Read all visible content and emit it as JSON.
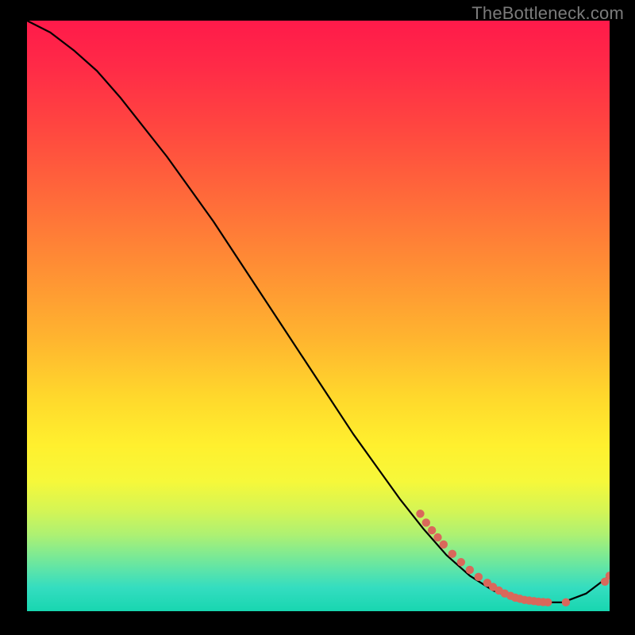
{
  "watermark": "TheBottleneck.com",
  "chart_data": {
    "type": "line",
    "title": "",
    "xlabel": "",
    "ylabel": "",
    "xlim": [
      0,
      100
    ],
    "ylim": [
      0,
      100
    ],
    "series": [
      {
        "name": "curve",
        "x": [
          0,
          4,
          8,
          12,
          16,
          20,
          24,
          28,
          32,
          36,
          40,
          44,
          48,
          52,
          56,
          60,
          64,
          68,
          72,
          76,
          80,
          84,
          88,
          92,
          96,
          100
        ],
        "y": [
          100,
          98,
          95,
          91.5,
          87,
          82,
          77,
          71.5,
          66,
          60,
          54,
          48,
          42,
          36,
          30,
          24.5,
          19,
          14,
          9.5,
          6,
          3.5,
          2,
          1.5,
          1.5,
          3,
          6
        ]
      }
    ],
    "markers": [
      {
        "x": 67.5,
        "y": 16.5
      },
      {
        "x": 68.5,
        "y": 15.0
      },
      {
        "x": 69.5,
        "y": 13.7
      },
      {
        "x": 70.5,
        "y": 12.5
      },
      {
        "x": 71.5,
        "y": 11.3
      },
      {
        "x": 73.0,
        "y": 9.7
      },
      {
        "x": 74.5,
        "y": 8.3
      },
      {
        "x": 76.0,
        "y": 7.0
      },
      {
        "x": 77.5,
        "y": 5.8
      },
      {
        "x": 79.0,
        "y": 4.8
      },
      {
        "x": 80.0,
        "y": 4.1
      },
      {
        "x": 81.0,
        "y": 3.5
      },
      {
        "x": 82.0,
        "y": 3.0
      },
      {
        "x": 83.0,
        "y": 2.6
      },
      {
        "x": 83.8,
        "y": 2.3
      },
      {
        "x": 84.6,
        "y": 2.1
      },
      {
        "x": 85.4,
        "y": 1.9
      },
      {
        "x": 86.2,
        "y": 1.8
      },
      {
        "x": 87.0,
        "y": 1.7
      },
      {
        "x": 87.8,
        "y": 1.6
      },
      {
        "x": 88.6,
        "y": 1.55
      },
      {
        "x": 89.4,
        "y": 1.5
      },
      {
        "x": 92.5,
        "y": 1.5
      },
      {
        "x": 99.2,
        "y": 5.0
      },
      {
        "x": 100,
        "y": 6.0
      }
    ],
    "gradient_stops": [
      {
        "t": 0.0,
        "color": "#ff1a4a"
      },
      {
        "t": 0.4,
        "color": "#ff8f34"
      },
      {
        "t": 0.72,
        "color": "#fff02e"
      },
      {
        "t": 1.0,
        "color": "#18d6b0"
      }
    ]
  }
}
